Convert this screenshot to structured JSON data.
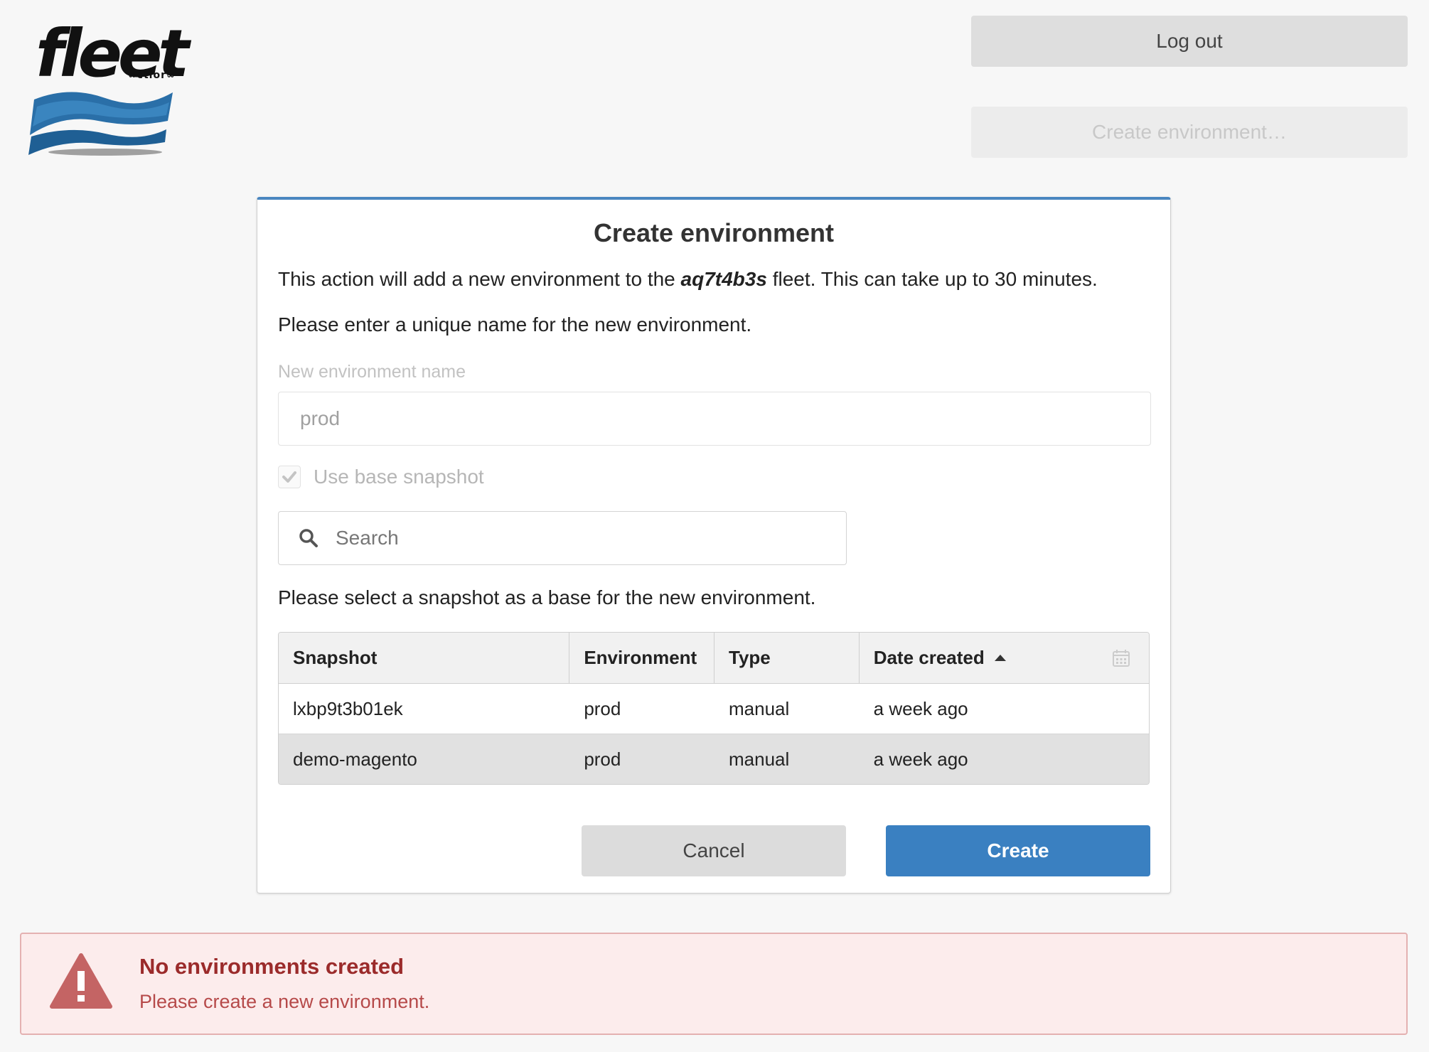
{
  "logo": {
    "text": "fleet",
    "subtext": "∞ctior∞",
    "icon": "fleet-wave-logo"
  },
  "header": {
    "logout_label": "Log out",
    "create_environment_label": "Create environment…"
  },
  "modal": {
    "title": "Create environment",
    "intro_prefix": "This action will add a new environment to the ",
    "fleet_name": "aq7t4b3s",
    "intro_suffix": " fleet. This can take up to 30 minutes.",
    "name_prompt": "Please enter a unique name for the new environment.",
    "name_label": "New environment name",
    "name_value": "prod",
    "base_snapshot_label": "Use base snapshot",
    "base_snapshot_checked": true,
    "search_placeholder": "Search",
    "snapshot_prompt": "Please select a snapshot as a base for the new environment.",
    "table": {
      "headers": [
        "Snapshot",
        "Environment",
        "Type",
        "Date created"
      ],
      "rows": [
        [
          "lxbp9t3b01ek",
          "prod",
          "manual",
          "a week ago"
        ],
        [
          "demo-magento",
          "prod",
          "manual",
          "a week ago"
        ]
      ]
    },
    "cancel_label": "Cancel",
    "create_label": "Create"
  },
  "alert": {
    "title": "No environments created",
    "message": "Please create a new environment.",
    "icon": "warning-icon"
  },
  "colors": {
    "accent": "#3a80c1",
    "alert_bg": "#fcecec",
    "alert_title": "#9b2b2b"
  }
}
